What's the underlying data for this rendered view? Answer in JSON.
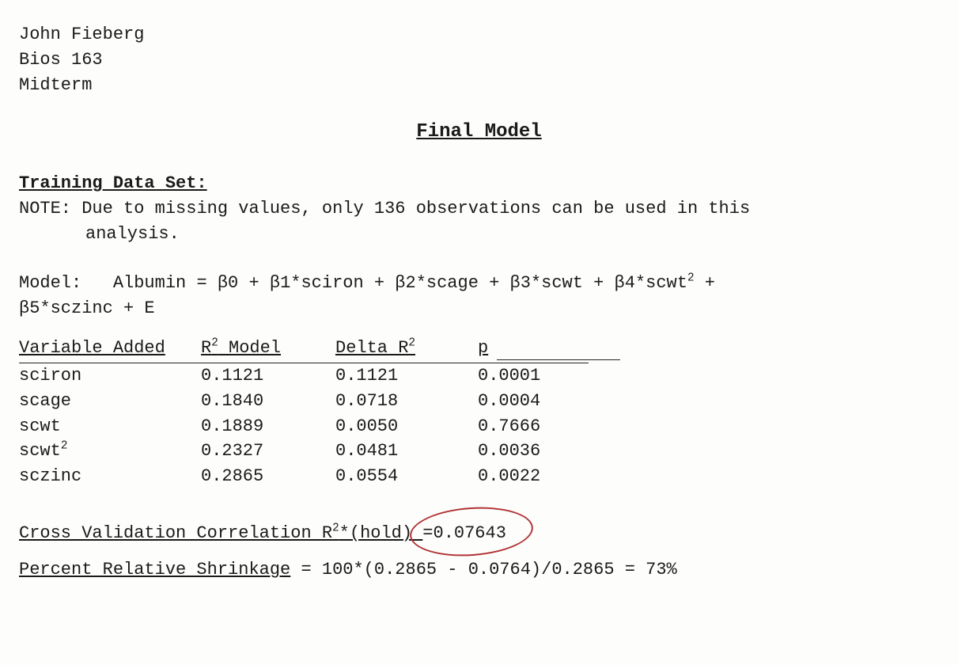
{
  "header": {
    "line1": "John Fieberg",
    "line2": "Bios 163",
    "line3": "Midterm"
  },
  "title": "Final Model",
  "training": {
    "label": "Training Data Set:",
    "note_prefix": "NOTE:",
    "note_text_1": "Due to missing values, only 136 observations can be used in this",
    "note_text_2": "analysis."
  },
  "model": {
    "label": "Model:",
    "equation_line1_plain": "Albumin = β0 + β1*sciron + β2*scage + β3*scwt + β4*scwt",
    "equation_sq": "2",
    "equation_tail1": " +",
    "equation_line2": "β5*sczinc + E"
  },
  "table": {
    "headers": {
      "var": "Variable Added",
      "r2": "R",
      "r2_sup": "2",
      "r2_tail": " Model",
      "delta": "Delta R",
      "delta_sup": "2",
      "p": "p"
    },
    "rows": [
      {
        "var": "sciron",
        "sq": "",
        "r2": "0.1121",
        "delta": "0.1121",
        "p": "0.0001"
      },
      {
        "var": "scage",
        "sq": "",
        "r2": "0.1840",
        "delta": "0.0718",
        "p": "0.0004"
      },
      {
        "var": "scwt",
        "sq": "",
        "r2": "0.1889",
        "delta": "0.0050",
        "p": "0.7666"
      },
      {
        "var": "scwt",
        "sq": "2",
        "r2": "0.2327",
        "delta": "0.0481",
        "p": "0.0036"
      },
      {
        "var": "sczinc",
        "sq": "",
        "r2": "0.2865",
        "delta": "0.0554",
        "p": "0.0022"
      }
    ]
  },
  "cv": {
    "label_a": "Cross Validation Correlation R",
    "label_sup": "2",
    "label_b": "*(hold)",
    "eq": "=",
    "value": "0.07643"
  },
  "shrink": {
    "label": "Percent Relative Shrinkage",
    "rest": " = 100*(0.2865 - 0.0764)/0.2865 = 73%"
  },
  "annotation": {
    "name": "red-circle",
    "color": "#b03336"
  }
}
